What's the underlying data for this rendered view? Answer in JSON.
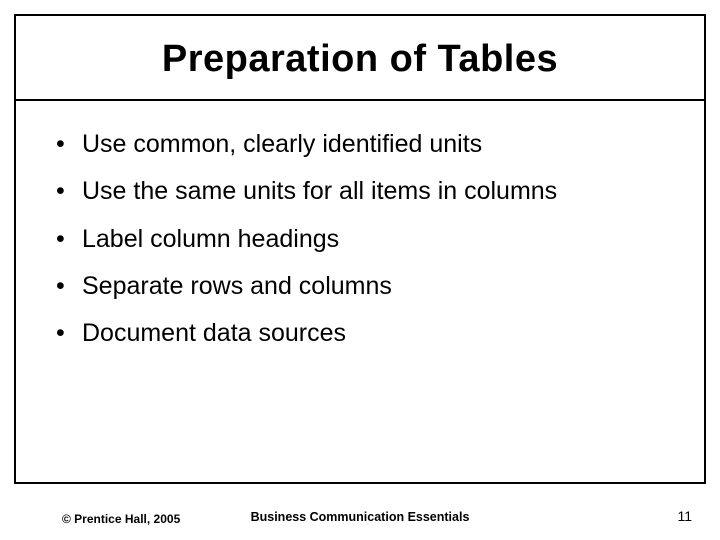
{
  "slide": {
    "title": "Preparation of Tables",
    "bullets": [
      "Use common, clearly identified units",
      "Use the same units for all items in columns",
      "Label column headings",
      "Separate rows and columns",
      "Document data sources"
    ]
  },
  "footer": {
    "copyright": "© Prentice Hall, 2005",
    "book": "Business Communication Essentials",
    "page": "11"
  }
}
